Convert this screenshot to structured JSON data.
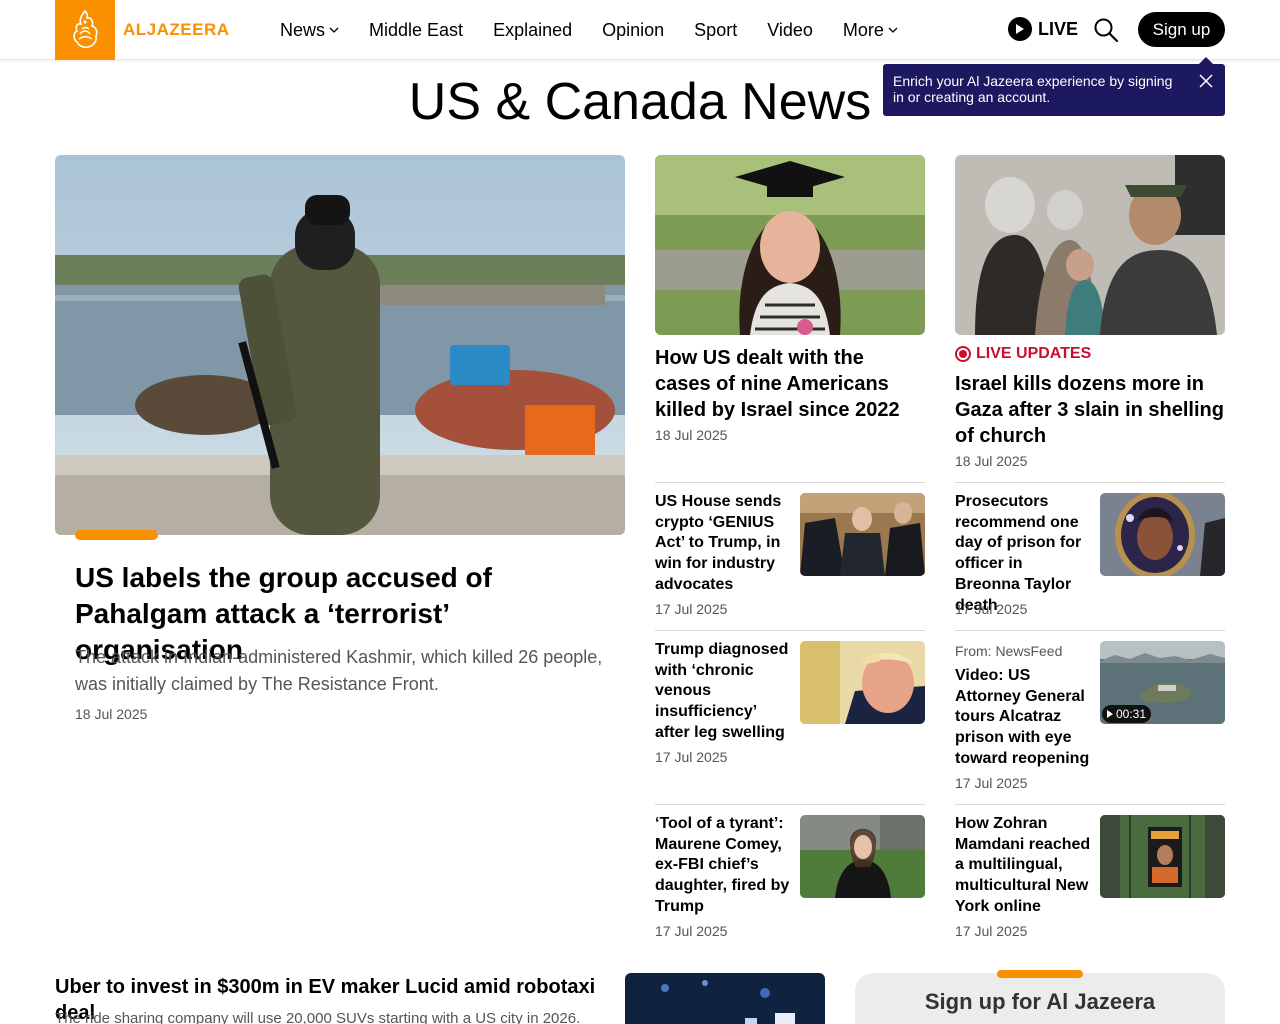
{
  "brand": {
    "name": "ALJAZEERA",
    "accent": "#fa9000"
  },
  "nav": [
    {
      "label": "News",
      "dropdown": true
    },
    {
      "label": "Middle East",
      "dropdown": false
    },
    {
      "label": "Explained",
      "dropdown": false
    },
    {
      "label": "Opinion",
      "dropdown": false
    },
    {
      "label": "Sport",
      "dropdown": false
    },
    {
      "label": "Video",
      "dropdown": false
    },
    {
      "label": "More",
      "dropdown": true
    }
  ],
  "header": {
    "live_label": "LIVE",
    "signup_label": "Sign up"
  },
  "tooltip": {
    "text": "Enrich your Al Jazeera experience by signing in or creating an account."
  },
  "page": {
    "title": "US & Canada News"
  },
  "featured": {
    "title": "US labels the group accused of Pahalgam attack a ‘terrorist’ organisation",
    "description": "The attack in Indian-administered Kashmir, which killed 26 people, was initially claimed by The Resistance Front.",
    "date": "18 Jul 2025"
  },
  "top_cards": [
    {
      "title": "How US dealt with the cases of nine Americans killed by Israel since 2022",
      "date": "18 Jul 2025"
    },
    {
      "badge": "LIVE UPDATES",
      "title": "Israel kills dozens more in Gaza after 3 slain in shelling of church",
      "date": "18 Jul 2025"
    }
  ],
  "stories_left": [
    {
      "title": "US House sends crypto ‘GENIUS Act’ to Trump, in win for industry advocates",
      "date": "17 Jul 2025"
    },
    {
      "title": "Trump diagnosed with ‘chronic venous insufficiency’ after leg swelling",
      "date": "17 Jul 2025"
    },
    {
      "title": "‘Tool of a tyrant’: Maurene Comey, ex-FBI chief’s daughter, fired by Trump",
      "date": "17 Jul 2025"
    }
  ],
  "stories_right": [
    {
      "title": "Prosecutors recommend one day of prison for officer in Breonna Taylor death",
      "date": "17 Jul 2025"
    },
    {
      "from": "From: NewsFeed",
      "title": "Video: US Attorney General tours Alcatraz prison with eye toward reopening",
      "date": "17 Jul 2025",
      "duration": "00:31"
    },
    {
      "title": "How Zohran Mamdani reached a multilingual, multicultural New York online",
      "date": "17 Jul 2025"
    }
  ],
  "bottom_story": {
    "title": "Uber to invest in $300m in EV maker Lucid amid robotaxi deal",
    "description": "The ride sharing company will use 20,000 SUVs starting with a US city in 2026."
  },
  "signup_box": {
    "title": "Sign up for Al Jazeera"
  },
  "icons": [
    "aljazeera-logo-icon",
    "chevron-down-icon",
    "play-icon",
    "search-icon",
    "close-icon",
    "live-ring-icon"
  ]
}
